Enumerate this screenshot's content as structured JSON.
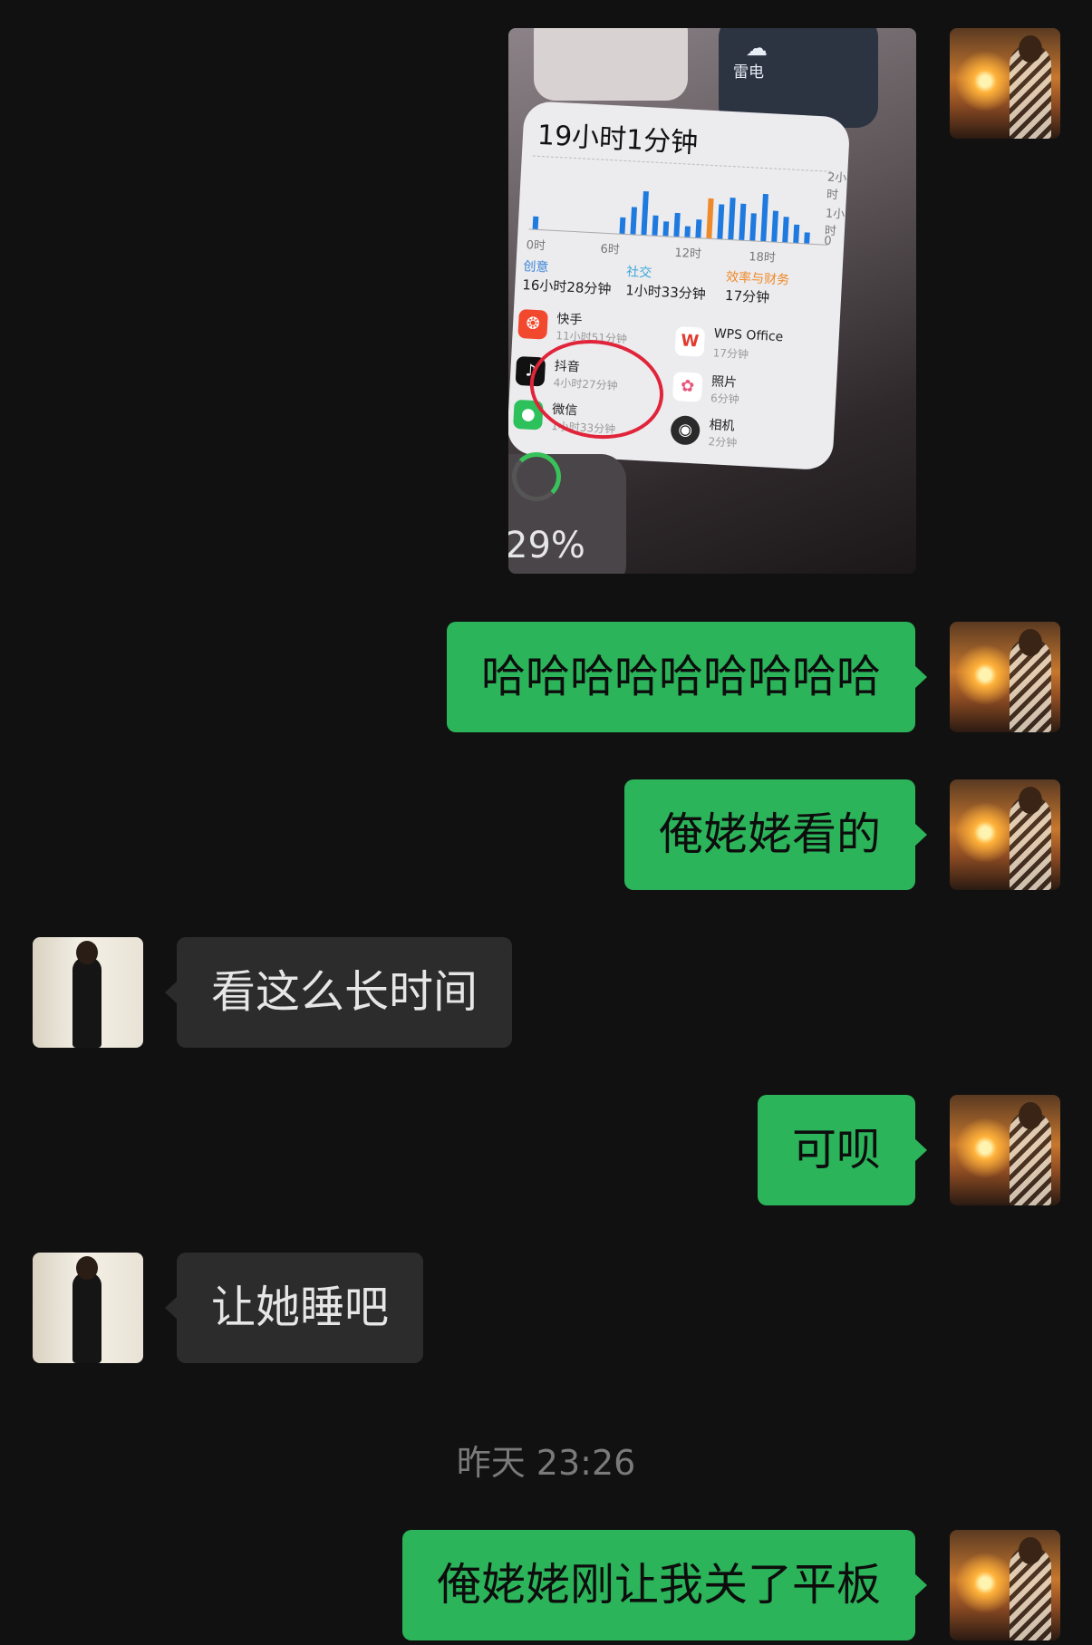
{
  "colors": {
    "background": "#111111",
    "my_bubble": "#2cb45a",
    "their_bubble": "#2c2c2c",
    "timestamp": "#7a7a7a"
  },
  "image_message": {
    "weather_label": "雷电",
    "weather_icon": "cloud-lightning-icon",
    "total_time": "19小时1分钟",
    "x_axis_ticks": [
      "0时",
      "6时",
      "12时",
      "18时"
    ],
    "y_axis_ticks": [
      "2小时",
      "1小时",
      "0"
    ],
    "categories": [
      {
        "name": "创意",
        "time": "16小时28分钟",
        "color": "#3a86d8"
      },
      {
        "name": "社交",
        "time": "1小时33分钟",
        "color": "#3aa8d8"
      },
      {
        "name": "效率与财务",
        "time": "17分钟",
        "color": "#ee8a2a"
      }
    ],
    "apps": [
      {
        "name": "快手",
        "time": "11小时51分钟",
        "icon": "kuaishou-icon"
      },
      {
        "name": "WPS Office",
        "time": "17分钟",
        "icon": "wps-icon"
      },
      {
        "name": "抖音",
        "time": "4小时27分钟",
        "icon": "douyin-icon"
      },
      {
        "name": "照片",
        "time": "6分钟",
        "icon": "photos-icon"
      },
      {
        "name": "微信",
        "time": "1小时33分钟",
        "icon": "wechat-icon"
      },
      {
        "name": "相机",
        "time": "2分钟",
        "icon": "camera-icon"
      }
    ],
    "battery_percent": "29%"
  },
  "messages": [
    {
      "sender": "me",
      "text": "哈哈哈哈哈哈哈哈哈"
    },
    {
      "sender": "me",
      "text": "俺姥姥看的"
    },
    {
      "sender": "them",
      "text": "看这么长时间"
    },
    {
      "sender": "me",
      "text": "可呗"
    },
    {
      "sender": "them",
      "text": "让她睡吧"
    },
    {
      "sender": "me",
      "text": "俺姥姥刚让我关了平板"
    }
  ],
  "timestamp": "昨天 23:26"
}
